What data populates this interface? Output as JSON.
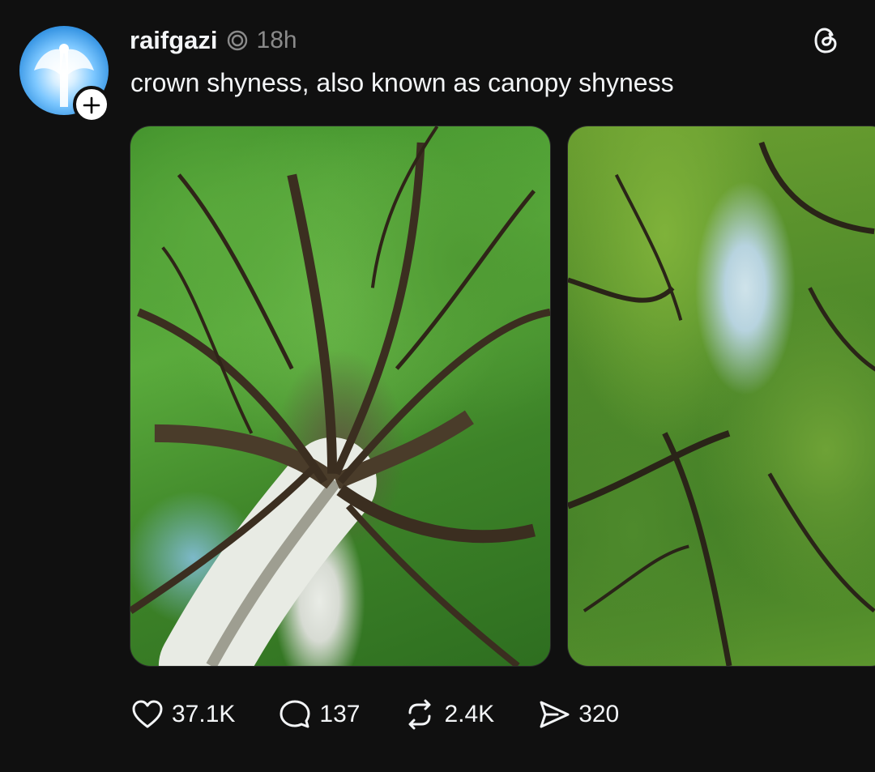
{
  "post": {
    "author": {
      "username": "raifgazi",
      "avatar_icon": "angel-avatar",
      "follow_icon": "plus-icon"
    },
    "timestamp": "18h",
    "caption": "crown shyness, also known as canopy shyness",
    "media": [
      {
        "description_icon": "tree-canopy-photo"
      },
      {
        "description_icon": "tree-canopy-photo"
      }
    ],
    "actions": {
      "likes": "37.1K",
      "replies": "137",
      "reposts": "2.4K",
      "shares": "320"
    }
  },
  "colors": {
    "background": "#101010",
    "text": "#f3f5f7",
    "muted": "#8a8a8a"
  }
}
